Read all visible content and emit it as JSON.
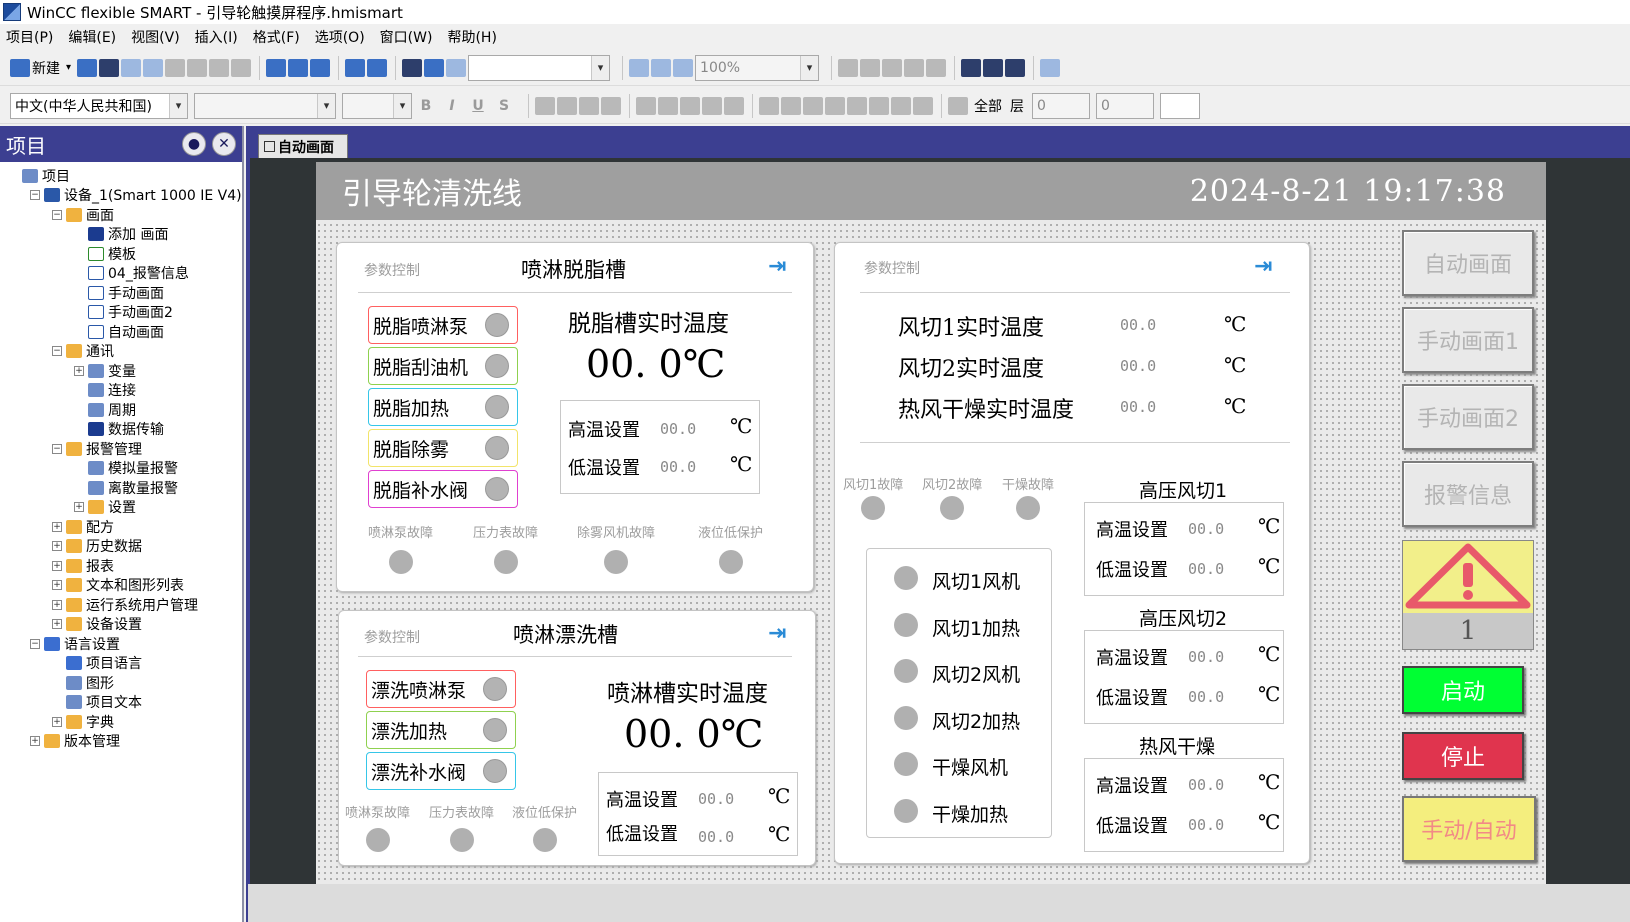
{
  "window": {
    "title": "WinCC flexible SMART - 引导轮触摸屏程序.hmismart"
  },
  "menu": [
    "项目(P)",
    "编辑(E)",
    "视图(V)",
    "插入(I)",
    "格式(F)",
    "选项(O)",
    "窗口(W)",
    "帮助(H)"
  ],
  "toolbar": {
    "new_label": "新建",
    "zoom": "100%",
    "language": "中文(中华人民共和国)",
    "all_label": "全部",
    "layer_label": "层",
    "spin1": "0",
    "spin2": "0"
  },
  "project": {
    "title": "项目",
    "tree": [
      {
        "label": "项目",
        "level": 0,
        "icon": "misc",
        "exp": ""
      },
      {
        "label": "设备_1(Smart 1000 IE V4)",
        "level": 1,
        "icon": "dev",
        "exp": "-"
      },
      {
        "label": "画面",
        "level": 2,
        "icon": "folder",
        "exp": "-"
      },
      {
        "label": "添加 画面",
        "level": 3,
        "icon": "add",
        "exp": ""
      },
      {
        "label": "模板",
        "level": 3,
        "icon": "tpl",
        "exp": ""
      },
      {
        "label": "04_报警信息",
        "level": 3,
        "icon": "page",
        "exp": ""
      },
      {
        "label": "手动画面",
        "level": 3,
        "icon": "page",
        "exp": ""
      },
      {
        "label": "手动画面2",
        "level": 3,
        "icon": "page",
        "exp": ""
      },
      {
        "label": "自动画面",
        "level": 3,
        "icon": "page",
        "exp": ""
      },
      {
        "label": "通讯",
        "level": 2,
        "icon": "folder",
        "exp": "-"
      },
      {
        "label": "变量",
        "level": 3,
        "icon": "misc",
        "exp": "+"
      },
      {
        "label": "连接",
        "level": 3,
        "icon": "misc",
        "exp": ""
      },
      {
        "label": "周期",
        "level": 3,
        "icon": "misc",
        "exp": ""
      },
      {
        "label": "数据传输",
        "level": 3,
        "icon": "add",
        "exp": ""
      },
      {
        "label": "报警管理",
        "level": 2,
        "icon": "folder",
        "exp": "-"
      },
      {
        "label": "模拟量报警",
        "level": 3,
        "icon": "misc",
        "exp": ""
      },
      {
        "label": "离散量报警",
        "level": 3,
        "icon": "misc",
        "exp": ""
      },
      {
        "label": "设置",
        "level": 3,
        "icon": "folder",
        "exp": "+"
      },
      {
        "label": "配方",
        "level": 2,
        "icon": "folder",
        "exp": "+"
      },
      {
        "label": "历史数据",
        "level": 2,
        "icon": "folder",
        "exp": "+"
      },
      {
        "label": "报表",
        "level": 2,
        "icon": "folder",
        "exp": "+"
      },
      {
        "label": "文本和图形列表",
        "level": 2,
        "icon": "folder",
        "exp": "+"
      },
      {
        "label": "运行系统用户管理",
        "level": 2,
        "icon": "folder",
        "exp": "+"
      },
      {
        "label": "设备设置",
        "level": 2,
        "icon": "folder",
        "exp": "+"
      },
      {
        "label": "语言设置",
        "level": 1,
        "icon": "globe",
        "exp": "-"
      },
      {
        "label": "项目语言",
        "level": 2,
        "icon": "globe",
        "exp": ""
      },
      {
        "label": "图形",
        "level": 2,
        "icon": "misc",
        "exp": ""
      },
      {
        "label": "项目文本",
        "level": 2,
        "icon": "misc",
        "exp": ""
      },
      {
        "label": "字典",
        "level": 2,
        "icon": "folder",
        "exp": "+"
      },
      {
        "label": "版本管理",
        "level": 1,
        "icon": "folder",
        "exp": "+"
      }
    ]
  },
  "editor_tab": "自动画面",
  "hmi": {
    "title": "引导轮清洗线",
    "clock": "2024-8-21  19:17:38",
    "p1": {
      "tag": "参数控制",
      "title": "喷淋脱脂槽",
      "nav": "⇥",
      "controls": [
        {
          "label": "脱脂喷淋泵",
          "color": "#ff6060"
        },
        {
          "label": "脱脂刮油机",
          "color": "#8fd14f"
        },
        {
          "label": "脱脂加热",
          "color": "#36c6e8"
        },
        {
          "label": "脱脂除雾",
          "color": "#f2e46a"
        },
        {
          "label": "脱脂补水阀",
          "color": "#e040d0"
        }
      ],
      "temp_label": "脱脂槽实时温度",
      "temp_value": "00. 0℃",
      "high_label": "高温设置",
      "high_value": "00.0",
      "low_label": "低温设置",
      "low_value": "00.0",
      "unit": "℃",
      "faults": [
        "喷淋泵故障",
        "压力表故障",
        "除雾风机故障",
        "液位低保护"
      ]
    },
    "p2": {
      "tag": "参数控制",
      "title": "喷淋漂洗槽",
      "nav": "⇥",
      "controls": [
        {
          "label": "漂洗喷淋泵",
          "color": "#ff6060"
        },
        {
          "label": "漂洗加热",
          "color": "#8fd14f"
        },
        {
          "label": "漂洗补水阀",
          "color": "#36c6e8"
        }
      ],
      "temp_label": "喷淋槽实时温度",
      "temp_value": "00. 0℃",
      "high_label": "高温设置",
      "high_value": "00.0",
      "low_label": "低温设置",
      "low_value": "00.0",
      "unit": "℃",
      "faults": [
        "喷淋泵故障",
        "压力表故障",
        "液位低保护"
      ]
    },
    "p3": {
      "tag": "参数控制",
      "nav": "⇥",
      "temps": [
        {
          "label": "风切1实时温度",
          "value": "00.0",
          "unit": "℃"
        },
        {
          "label": "风切2实时温度",
          "value": "00.0",
          "unit": "℃"
        },
        {
          "label": "热风干燥实时温度",
          "value": "00.0",
          "unit": "℃"
        }
      ],
      "faults": [
        "风切1故障",
        "风切2故障",
        "干燥故障"
      ],
      "lamps": [
        "风切1风机",
        "风切1加热",
        "风切2风机",
        "风切2加热",
        "干燥风机",
        "干燥加热"
      ],
      "groups": [
        {
          "title": "高压风切1",
          "high_label": "高温设置",
          "high_value": "00.0",
          "low_label": "低温设置",
          "low_value": "00.0",
          "unit": "℃"
        },
        {
          "title": "高压风切2",
          "high_label": "高温设置",
          "high_value": "00.0",
          "low_label": "低温设置",
          "low_value": "00.0",
          "unit": "℃"
        },
        {
          "title": "热风干燥",
          "high_label": "高温设置",
          "high_value": "00.0",
          "low_label": "低温设置",
          "low_value": "00.0",
          "unit": "℃"
        }
      ]
    },
    "nav": [
      "自动画面",
      "手动画面1",
      "手动画面2",
      "报警信息"
    ],
    "alarm_count": "1",
    "start_label": "启动",
    "stop_label": "停止",
    "mode_label": "手动/自动",
    "colors": {
      "start": "#00ff33",
      "stop": "#e0344e",
      "mode": "#f4ee7e",
      "alarm_bg": "#f2ef8a"
    }
  }
}
